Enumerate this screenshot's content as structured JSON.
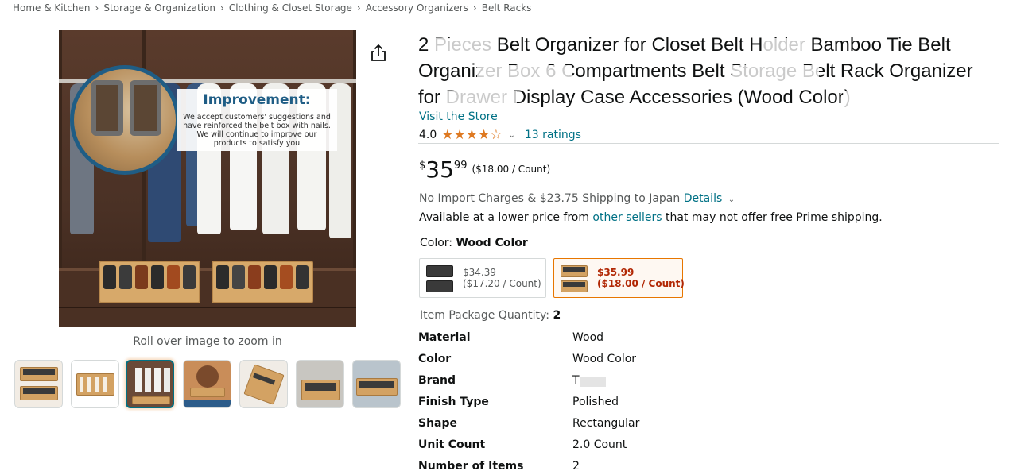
{
  "breadcrumb": [
    "Home & Kitchen",
    "Storage & Organization",
    "Clothing & Closet Storage",
    "Accessory Organizers",
    "Belt Racks"
  ],
  "breadcrumb_separator": "›",
  "image": {
    "improve_title": "Improvement:",
    "improve_body": "We accept customers' suggestions and have reinforced the belt box with nails. We will continue to improve our products to satisfy you",
    "zoom_hint": "Roll over image to zoom in",
    "thumbnail_count": 7,
    "selected_thumbnail_index": 2
  },
  "product": {
    "title": "2 Pieces Belt Organizer for Closet Belt Holder Bamboo Tie Belt Organizer Box 6 Compartments Belt Storage Belt Rack Organizer for Drawer Display Case Accessories (Wood Color)",
    "store_link": "Visit the Store",
    "rating_value": "4.0",
    "stars": "★★★★☆",
    "ratings_count": "13 ratings"
  },
  "price": {
    "symbol": "$",
    "whole": "35",
    "fraction": "99",
    "per_unit": "($18.00 / Count)"
  },
  "shipping": {
    "text": "No Import Charges & $23.75 Shipping to Japan",
    "details_link": "Details"
  },
  "availability": {
    "prefix": "Available at a lower price from",
    "link": "other sellers",
    "suffix": "that may not offer free Prime shipping."
  },
  "color": {
    "label": "Color:",
    "value": "Wood Color",
    "options": [
      {
        "price": "$34.39",
        "unit": "($17.20 / Count)"
      },
      {
        "price": "$35.99",
        "unit": "($18.00 / Count)"
      }
    ]
  },
  "package": {
    "label": "Item Package Quantity:",
    "value": "2"
  },
  "specs": [
    {
      "label": "Material",
      "value": "Wood"
    },
    {
      "label": "Color",
      "value": "Wood Color"
    },
    {
      "label": "Brand",
      "value": "T"
    },
    {
      "label": "Finish Type",
      "value": "Polished"
    },
    {
      "label": "Shape",
      "value": "Rectangular"
    },
    {
      "label": "Unit Count",
      "value": "2.0 Count"
    },
    {
      "label": "Number of Items",
      "value": "2"
    }
  ],
  "colors": {
    "link": "#007185",
    "star": "#de7921",
    "selected_border": "#e77600",
    "deal_price": "#b12704",
    "accent_blue": "#1f5d85"
  }
}
